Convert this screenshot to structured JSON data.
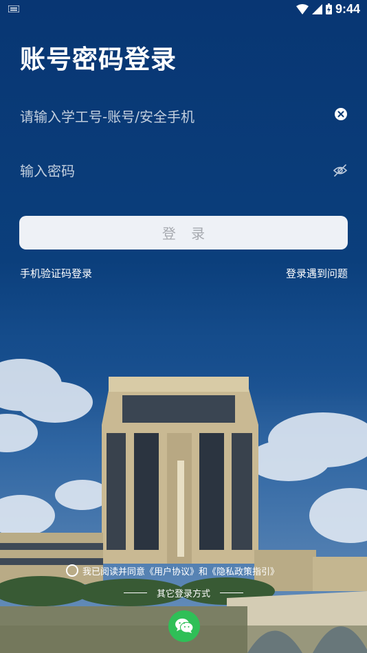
{
  "status_bar": {
    "time": "9:44"
  },
  "page": {
    "title": "账号密码登录"
  },
  "form": {
    "account_placeholder": "请输入学工号-账号/安全手机",
    "password_placeholder": "输入密码",
    "login_label": "登 录"
  },
  "links": {
    "sms_login": "手机验证码登录",
    "login_help": "登录遇到问题"
  },
  "agreement": {
    "prefix": "我已阅读并同意",
    "user_agreement": "《用户协议》",
    "and": "和",
    "privacy_policy": "《隐私政策指引》"
  },
  "other_login": {
    "label": "其它登录方式"
  },
  "colors": {
    "background": "#0b3a73",
    "button_bg": "#eef1f6",
    "wechat_green": "#2fbf57"
  }
}
